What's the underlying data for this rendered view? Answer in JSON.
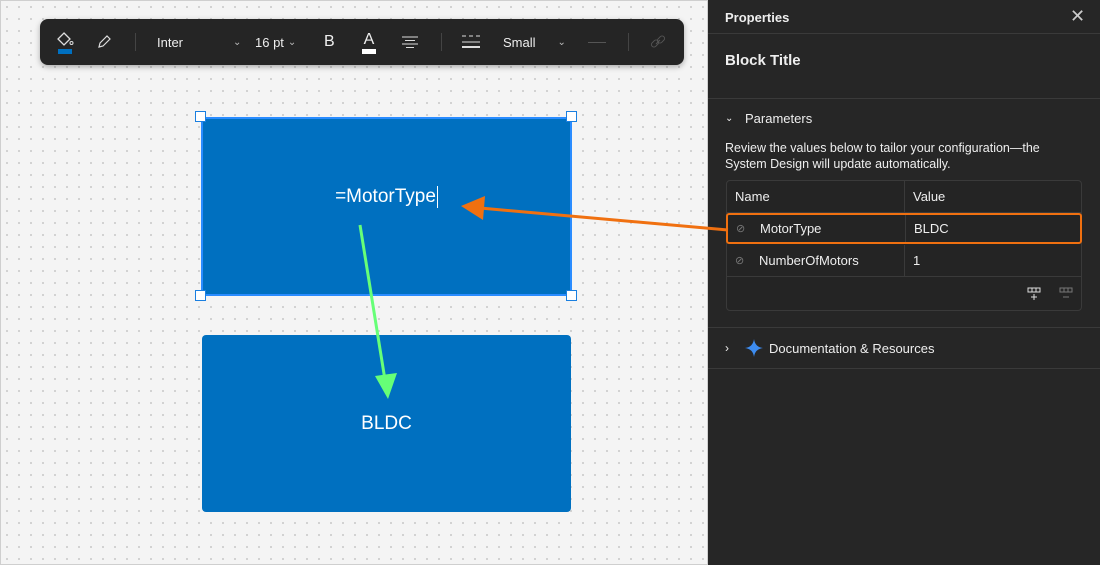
{
  "toolbar": {
    "font": "Inter",
    "size": "16 pt",
    "bold": "B",
    "text_color": "A",
    "stroke_size": "Small",
    "fill_color": "#0070c0"
  },
  "canvas": {
    "block1_text": "=MotorType",
    "block2_text": "BLDC"
  },
  "panel": {
    "title": "Properties",
    "block_title": "Block Title",
    "parameters_label": "Parameters",
    "description": "Review the values below to tailor your configuration—the System Design will update automatically.",
    "table": {
      "headers": [
        "Name",
        "Value"
      ],
      "rows": [
        {
          "name": "MotorType",
          "value": "BLDC"
        },
        {
          "name": "NumberOfMotors",
          "value": "1"
        }
      ]
    },
    "documentation_label": "Documentation & Resources"
  },
  "colors": {
    "highlight": "#f07010",
    "arrow_green": "#66ff77",
    "block": "#0070c0"
  }
}
